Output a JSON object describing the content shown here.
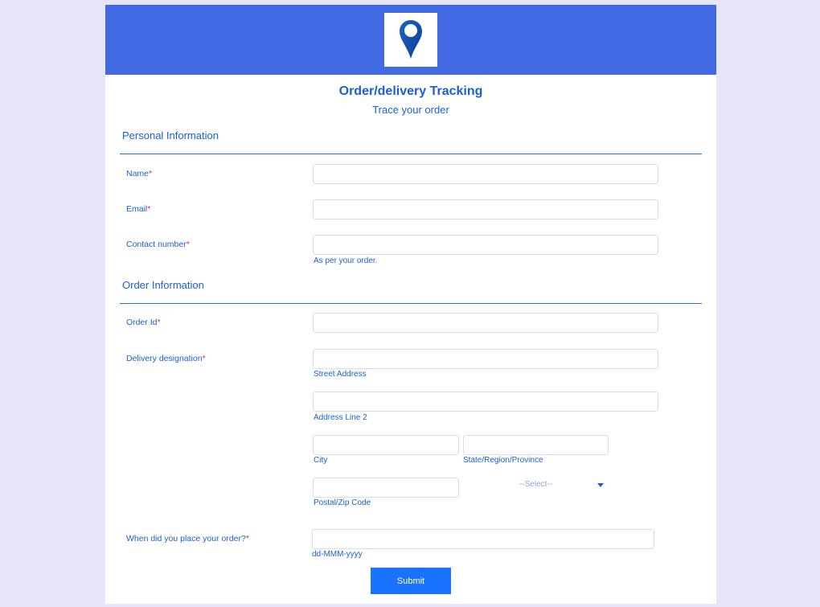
{
  "header": {
    "title": "Order/delivery Tracking",
    "subtitle": "Trace your order",
    "logo_icon": "map-pin-icon",
    "banner_color": "#4169e1"
  },
  "sections": {
    "personal": "Personal Information",
    "order": "Order Information"
  },
  "fields": {
    "name": {
      "label": "Name",
      "value": ""
    },
    "email": {
      "label": "Email",
      "value": ""
    },
    "contact": {
      "label": "Contact number",
      "value": "",
      "hint": "As per your order."
    },
    "order_id": {
      "label": "Order Id",
      "value": ""
    },
    "delivery": {
      "label": "Delivery designation",
      "street_hint": "Street Address",
      "line2_hint": "Address Line 2",
      "city_hint": "City",
      "state_hint": "State/Region/Province",
      "zip_hint": "Postal/Zip Code",
      "country_select": "--Select--"
    },
    "order_date": {
      "label": "When did you place your order?",
      "hint": "dd-MMM-yyyy"
    }
  },
  "required_mark": "*",
  "submit_label": "Submit",
  "colors": {
    "accent": "#1a5fd6",
    "required": "#e0245e",
    "button": "#1a73ff"
  }
}
